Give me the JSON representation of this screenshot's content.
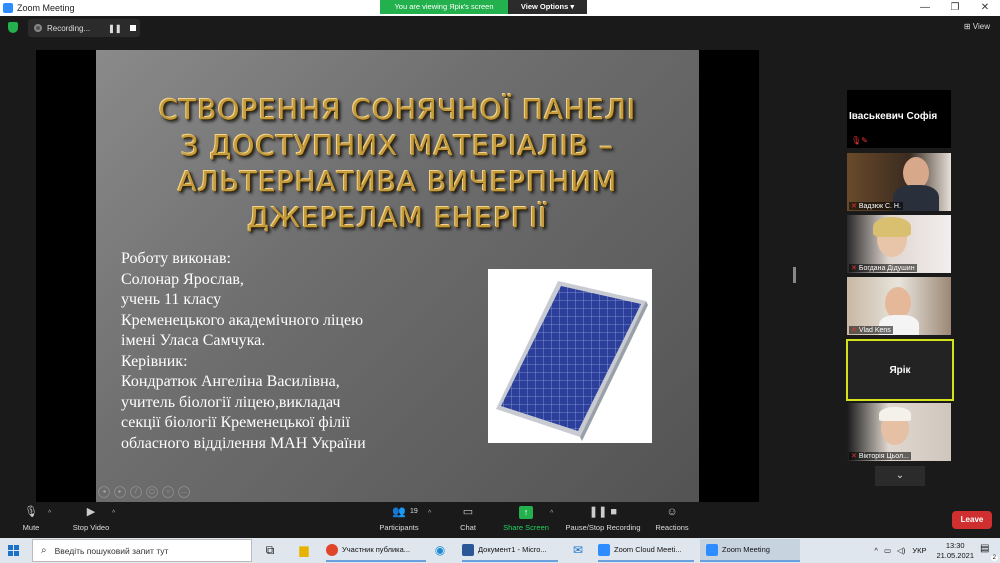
{
  "window": {
    "title": "Zoom Meeting",
    "min": "—",
    "max": "❐",
    "close": "✕"
  },
  "banner": {
    "viewing": "You are viewing Ярік's screen",
    "view_options": "View Options ▾"
  },
  "recording": {
    "label": "Recording...",
    "pause": "❚❚"
  },
  "view_button": "⊞ View",
  "slide": {
    "title_lines": [
      "СТВОРЕННЯ СОНЯЧНОЇ ПАНЕЛІ",
      "З ДОСТУПНИХ МАТЕРІАЛІВ –",
      "АЛЬТЕРНАТИВА ВИЧЕРПНИМ",
      "ДЖЕРЕЛАМ ЕНЕРГІЇ"
    ],
    "body_lines": [
      "Роботу виконав:",
      "  Солонар Ярослав,",
      "  учень 11 класу",
      "  Кременецького академічного ліцею",
      "  імені Уласа Самчука.",
      "  Керівник:",
      "  Кондратюк Ангеліна Василівна,",
      "   учитель біології ліцею,викладач",
      "  секції біології Кременецької філії",
      "  обласного відділення МАН України"
    ]
  },
  "participants_panel": {
    "active_speaker": "Іваськевич  Софія",
    "tiles": [
      {
        "name": "Вадзюк С. Н."
      },
      {
        "name": "Богдана Дідушин"
      },
      {
        "name": "Vlad Kens"
      },
      {
        "name": "Ярік"
      },
      {
        "name": "Вікторія Цьол..."
      }
    ],
    "more": "⌄"
  },
  "toolbar": {
    "mute": "Mute",
    "stop_video": "Stop Video",
    "participants": "Participants",
    "participants_count": "19",
    "chat": "Chat",
    "share_screen": "Share Screen",
    "pause_recording": "Pause/Stop Recording",
    "reactions": "Reactions",
    "leave": "Leave"
  },
  "taskbar": {
    "search_placeholder": "Введіть пошуковий запит тут",
    "tasks": [
      {
        "label": "Участник публика...",
        "color": "#e0442b"
      },
      {
        "label": "Документ1 - Micro...",
        "color": "#2b5797"
      },
      {
        "label": "Zoom Cloud Meeti...",
        "color": "#2d8cff"
      },
      {
        "label": "Zoom Meeting",
        "color": "#2d8cff"
      }
    ],
    "language": "УКР",
    "time": "13:30",
    "date": "21.05.2021",
    "notifications": "2"
  },
  "colors": {
    "accent_green": "#23b14d",
    "leave_red": "#d02f2f",
    "active_border": "#d4e21c",
    "slide_title": "#c49a3a"
  }
}
